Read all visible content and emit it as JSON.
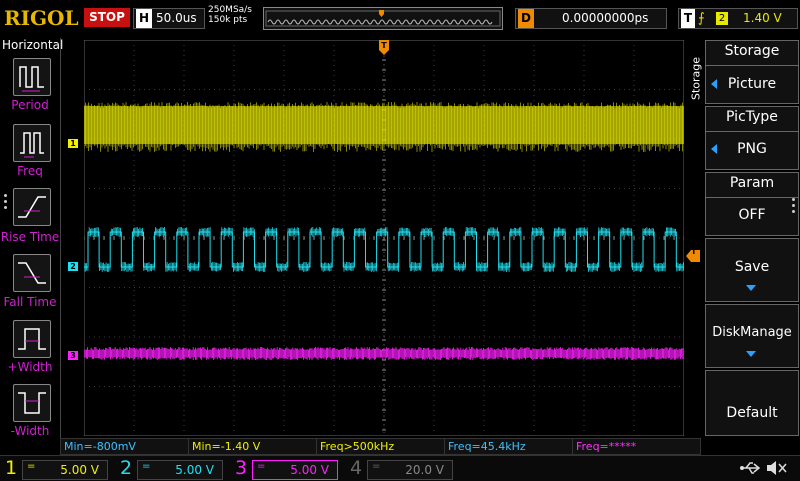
{
  "top": {
    "logo": "RIGOL",
    "run_state": "STOP",
    "timebase_letter": "H",
    "timebase": "50.0us",
    "sample_rate": "250MSa/s",
    "memory_depth": "150k pts",
    "delay_letter": "D",
    "delay": "0.00000000ps",
    "trigger_letter": "T",
    "trigger_edge": "⨍",
    "trigger_source": "2",
    "trigger_level": "1.40 V"
  },
  "left_panel": {
    "title": "Horizontal",
    "items": [
      {
        "label": "Period",
        "icon": "period-icon"
      },
      {
        "label": "Freq",
        "icon": "freq-icon"
      },
      {
        "label": "Rise Time",
        "icon": "rise-time-icon"
      },
      {
        "label": "Fall Time",
        "icon": "fall-time-icon"
      },
      {
        "label": "+Width",
        "icon": "positive-width-icon"
      },
      {
        "label": "-Width",
        "icon": "negative-width-icon"
      }
    ]
  },
  "right_panel": {
    "side_label": "Storage",
    "title": "Storage",
    "storage_value": "Picture",
    "pictype_title": "PicType",
    "pictype_value": "PNG",
    "param_title": "Param",
    "param_value": "OFF",
    "save_label": "Save",
    "diskmanage_label": "DiskManage",
    "default_label": "Default"
  },
  "channel_markers": {
    "ch1": "1",
    "ch2": "2",
    "ch3": "3",
    "trigger_pos": "T"
  },
  "measurements": [
    {
      "text": "Min=-800mV",
      "color": "#3fc0ff"
    },
    {
      "text": "Min=-1.40 V",
      "color": "#f0f000"
    },
    {
      "text": "Freq>500kHz",
      "color": "#f0f000"
    },
    {
      "text": "Freq=45.4kHz",
      "color": "#3fc0ff"
    },
    {
      "text": "Freq=*****",
      "color": "#ff30ff"
    }
  ],
  "channels": [
    {
      "num": "1",
      "coupling": "=",
      "scale": "5.00 V",
      "color": "#f0f000"
    },
    {
      "num": "2",
      "coupling": "=",
      "scale": "5.00 V",
      "color": "#20e0f0"
    },
    {
      "num": "3",
      "coupling": "=",
      "scale": "5.00 V",
      "color": "#ff20ff"
    },
    {
      "num": "4",
      "coupling": "=",
      "scale": "20.0 V",
      "color": "#666666"
    }
  ],
  "colors": {
    "ch1": "#f0f000",
    "ch2": "#20e0f0",
    "ch3": "#ff20ff",
    "trigger": "#f08a00",
    "menu_label": "#d020d0"
  }
}
